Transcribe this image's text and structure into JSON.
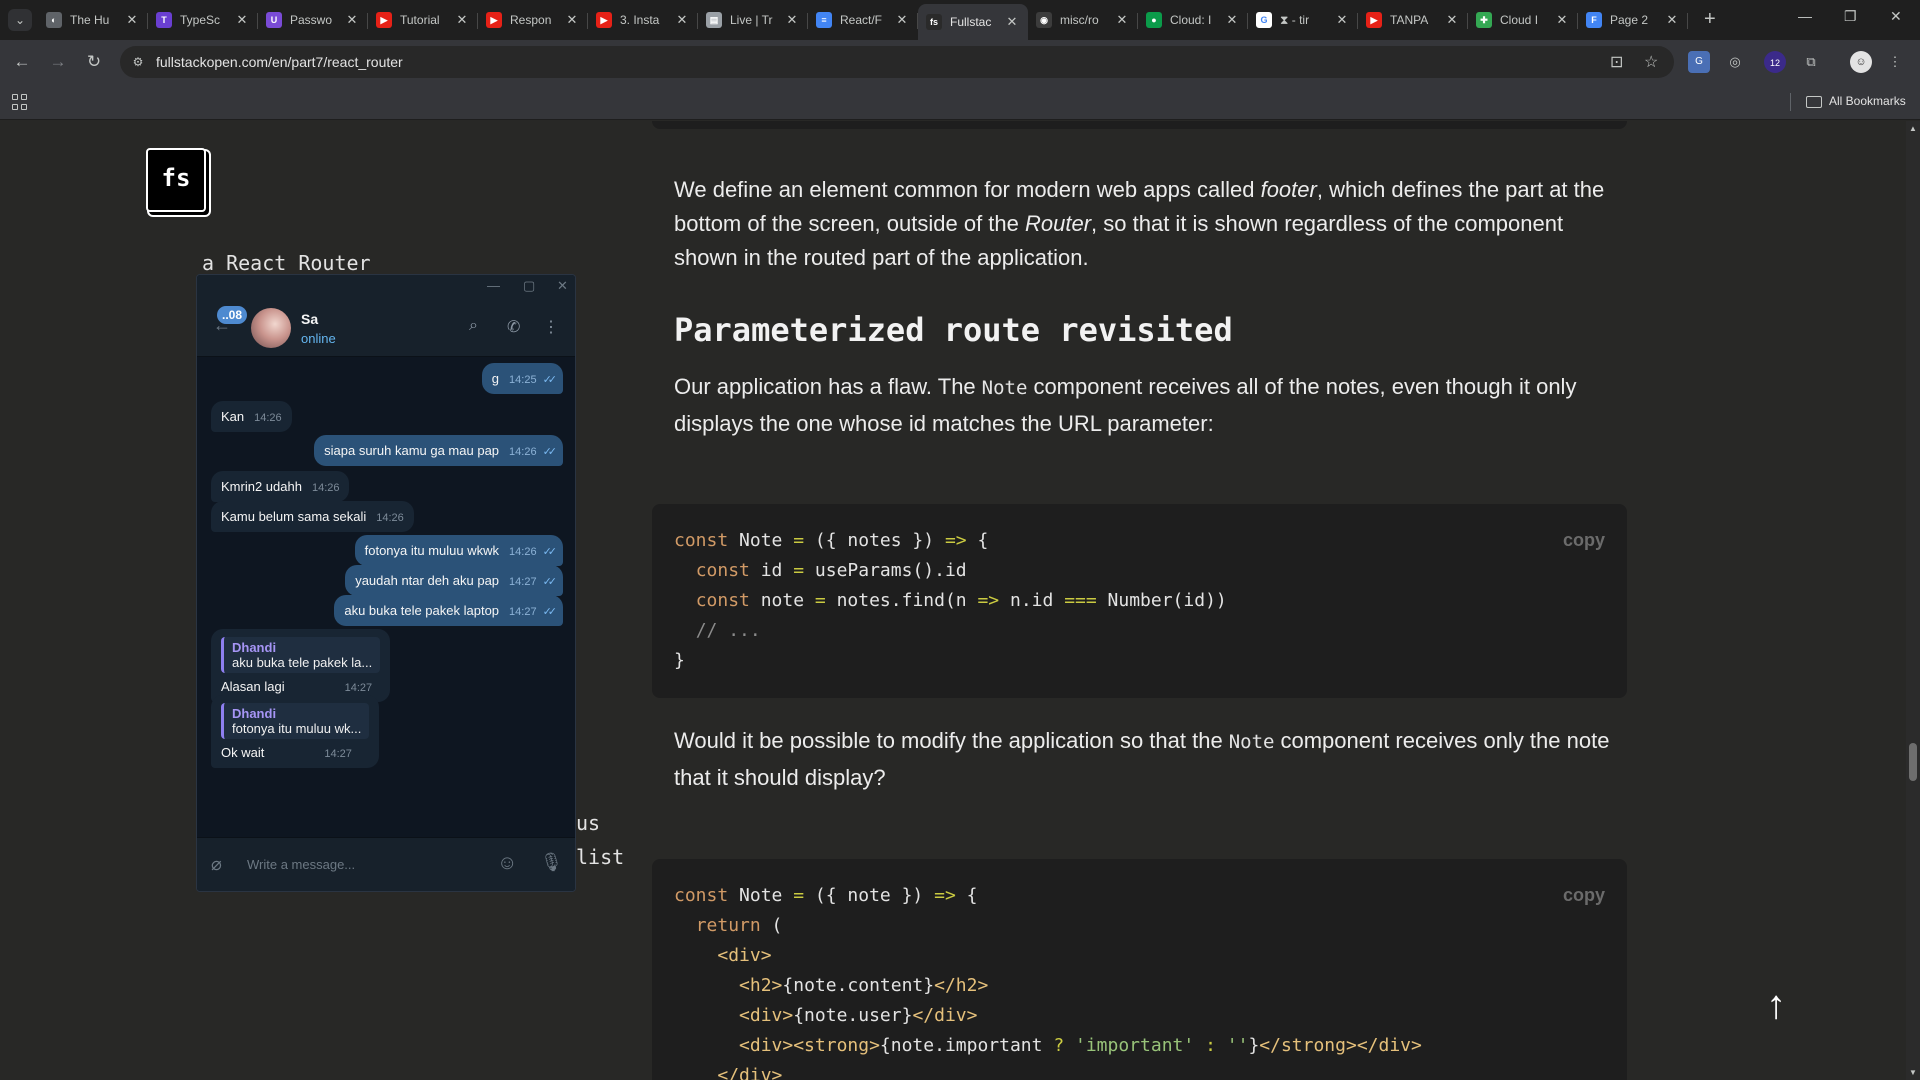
{
  "browser": {
    "tabs": [
      {
        "title": "The Hu",
        "fav_color": "#5f6368",
        "fav_glyph": "◐"
      },
      {
        "title": "TypeSc",
        "fav_color": "#6a3fd1",
        "fav_glyph": "T"
      },
      {
        "title": "Passwo",
        "fav_color": "#7a4bd6",
        "fav_glyph": "U"
      },
      {
        "title": "Tutorial",
        "fav_color": "#e62117",
        "fav_glyph": "▶"
      },
      {
        "title": "Respon",
        "fav_color": "#e62117",
        "fav_glyph": "▶"
      },
      {
        "title": "3. Insta",
        "fav_color": "#e62117",
        "fav_glyph": "▶"
      },
      {
        "title": "Live | Tr",
        "fav_color": "#9aa0a6",
        "fav_glyph": "▤"
      },
      {
        "title": "React/F",
        "fav_color": "#4285f4",
        "fav_glyph": "≡"
      },
      {
        "title": "Fullstac",
        "fav_color": "#2a2a2a",
        "fav_glyph": "fs"
      },
      {
        "title": "misc/ro",
        "fav_color": "#3c3c3c",
        "fav_glyph": "◉"
      },
      {
        "title": "Cloud: I",
        "fav_color": "#0b9b4a",
        "fav_glyph": "●"
      },
      {
        "title": "⧗ - tir",
        "fav_color": "#ffffff",
        "fav_glyph": "G"
      },
      {
        "title": "TANPA",
        "fav_color": "#e62117",
        "fav_glyph": "▶"
      },
      {
        "title": "Cloud I",
        "fav_color": "#34a853",
        "fav_glyph": "✚"
      },
      {
        "title": "Page 2",
        "fav_color": "#4285f4",
        "fav_glyph": "F"
      }
    ],
    "active_tab": 8,
    "url": "fullstackopen.com/en/part7/react_router",
    "bookmarks_label": "All Bookmarks",
    "ext_badge": "12"
  },
  "page": {
    "logo": "fs",
    "side_texts": [
      "a React Router",
      "us",
      "list"
    ],
    "footer_para": {
      "a": "We define an element common for modern web apps called ",
      "b": "footer",
      "c": ", which defines the part at the bottom of the screen, outside of the ",
      "d": "Router",
      "e": ", so that it is shown regardless of the component shown in the routed part of the application."
    },
    "heading": "Parameterized route revisited",
    "flaw_para": {
      "a": "Our application has a flaw. The",
      "code": "Note",
      "b": "component receives all of the notes, even though it only displays the one whose id matches the URL parameter:"
    },
    "question_para": {
      "a": "Would it be possible to modify the application so that the",
      "code": "Note",
      "b": "component receives only the note that it should display?"
    },
    "copy_label": "copy"
  },
  "telegram": {
    "contact_name": "Sa",
    "status": "online",
    "unread_badge": "..08",
    "input_placeholder": "Write a message...",
    "messages": [
      {
        "dir": "out",
        "text": "g",
        "time": "14:25"
      },
      {
        "dir": "in",
        "text": "Kan",
        "time": "14:26"
      },
      {
        "dir": "out",
        "text": "siapa suruh kamu ga mau pap",
        "time": "14:26"
      },
      {
        "dir": "in",
        "text": "Kmrin2 udahh",
        "time": "14:26"
      },
      {
        "dir": "in",
        "text": "Kamu belum sama sekali",
        "time": "14:26"
      },
      {
        "dir": "out",
        "text": "fotonya itu muluu wkwk",
        "time": "14:26"
      },
      {
        "dir": "out",
        "text": "yaudah ntar deh aku pap",
        "time": "14:27"
      },
      {
        "dir": "out",
        "text": "aku buka tele pakek laptop",
        "time": "14:27"
      },
      {
        "dir": "in",
        "reply_name": "Dhandi",
        "reply_text": "aku buka tele pakek la...",
        "text": "Alasan lagi",
        "time": "14:27"
      },
      {
        "dir": "in",
        "reply_name": "Dhandi",
        "reply_text": "fotonya itu muluu wk...",
        "text": "Ok wait",
        "time": "14:27"
      }
    ]
  }
}
